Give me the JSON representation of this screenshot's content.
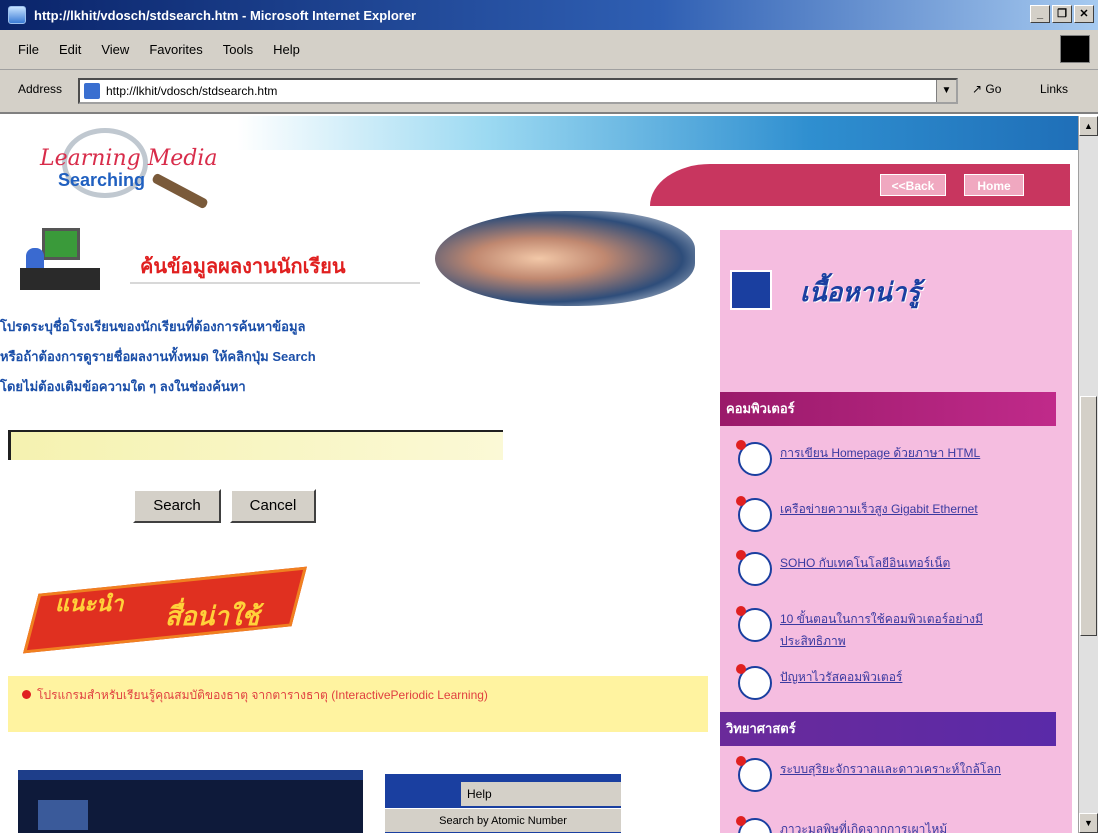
{
  "window": {
    "title": "http://lkhit/vdosch/stdsearch.htm - Microsoft Internet Explorer",
    "controls": [
      "_",
      "❐",
      "✕"
    ]
  },
  "menu": [
    "File",
    "Edit",
    "View",
    "Favorites",
    "Tools",
    "Help"
  ],
  "address": {
    "label": "Address",
    "url": "http://lkhit/vdosch/stdsearch.htm",
    "go": "Go",
    "links": "Links"
  },
  "logo": {
    "line1": "Learning Media",
    "line2": "Searching"
  },
  "nav": {
    "back": "<<Back",
    "home": "Home"
  },
  "headline": "ค้นข้อมูลผลงานนักเรียน",
  "intro": [
    "โปรดระบุชื่อโรงเรียนของนักเรียนที่ต้องการค้นหาข้อมูล",
    "หรือถ้าต้องการดูรายชื่อผลงานทั้งหมด ให้คลิกปุ่ม Search",
    "โดยไม่ต้องเติมข้อความใด ๆ ลงในช่องค้นหา"
  ],
  "search": {
    "value": "",
    "search_label": "Search",
    "cancel_label": "Cancel"
  },
  "promo": {
    "line1": "แนะนำ",
    "line2": "สื่อน่าใช้"
  },
  "recommended_app": "โปรแกรมสำหรับเรียนรู้คุณสมบัติของธาตุ จากตารางธาตุ (InteractivePeriodic Learning)",
  "help_panel": {
    "help": "Help",
    "search_by": "Search by Atomic Number"
  },
  "sidebar": {
    "title": "เนื้อหาน่ารู้",
    "categories": [
      {
        "name": "คอมพิวเตอร์",
        "items": [
          "การเขียน Homepage ด้วยภาษา HTML",
          "เครือข่ายความเร็วสูง Gigabit Ethernet",
          "SOHO กับเทคโนโลยีอินเทอร์เน็ต",
          "10 ขั้นตอนในการใช้คอมพิวเตอร์อย่างมีประสิทธิภาพ",
          "ปัญหาไวรัสคอมพิวเตอร์"
        ]
      },
      {
        "name": "วิทยาศาสตร์",
        "items": [
          "ระบบสุริยะจักรวาลและดาวเคราะห์ใกล้โลก",
          "ภาวะมลพิษที่เกิดจากการเผาไหม้"
        ]
      }
    ]
  }
}
